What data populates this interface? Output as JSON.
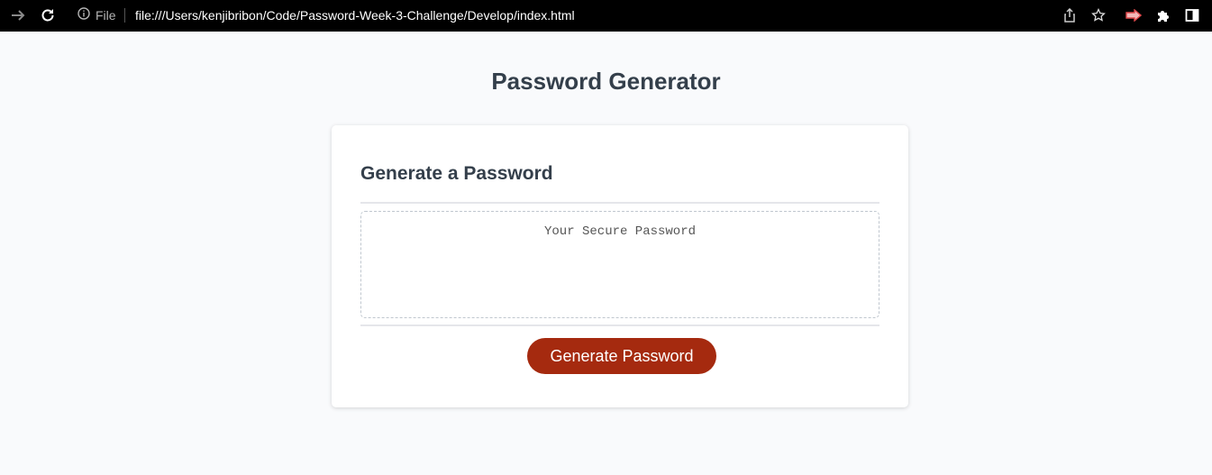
{
  "browser": {
    "site_info_label": "File",
    "url": "file:///Users/kenjibribon/Code/Password-Week-3-Challenge/Develop/index.html",
    "icons": [
      "forward-icon",
      "reload-icon",
      "info-icon",
      "share-icon",
      "bookmark-star-icon",
      "extension-icon",
      "puzzle-icon",
      "sidebar-icon"
    ]
  },
  "page": {
    "title": "Password Generator",
    "card": {
      "title": "Generate a Password",
      "password_placeholder": "Your Secure Password",
      "generate_button": "Generate Password"
    }
  },
  "colors": {
    "heading": "#343f4b",
    "button": "#a52a0f",
    "background": "#f9fafc"
  }
}
